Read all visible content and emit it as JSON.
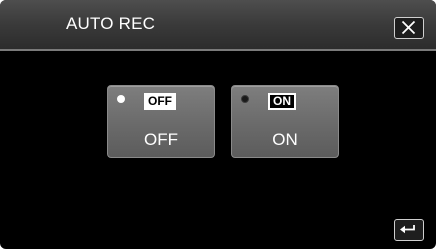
{
  "header": {
    "title": "AUTO REC"
  },
  "options": [
    {
      "badge": "OFF",
      "label": "OFF",
      "selected": true
    },
    {
      "badge": "ON",
      "label": "ON",
      "selected": false
    }
  ],
  "icons": {
    "close": "close-icon",
    "back": "return-arrow-icon",
    "radio": "radio-indicator-icon"
  },
  "colors": {
    "background": "#000000",
    "header": "#3a3a3a",
    "button": "#6a6a6a",
    "text": "#ffffff"
  }
}
